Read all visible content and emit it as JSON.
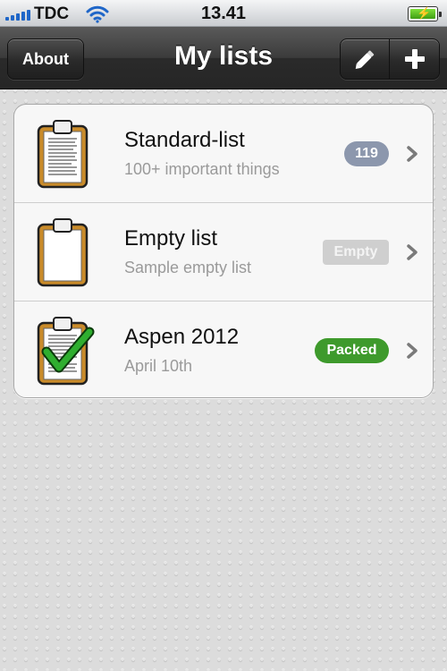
{
  "status_bar": {
    "carrier": "TDC",
    "time": "13.41",
    "icons": [
      "signal-icon",
      "wifi-icon",
      "battery-charging-icon"
    ]
  },
  "nav": {
    "title": "My lists",
    "about_label": "About",
    "icons": [
      "pencil-icon",
      "plus-icon"
    ]
  },
  "lists": [
    {
      "title": "Standard-list",
      "subtitle": "100+ important things",
      "badge": "119",
      "badge_style": "count",
      "icon": "clipboard-filled-icon"
    },
    {
      "title": "Empty list",
      "subtitle": "Sample empty list",
      "badge": "Empty",
      "badge_style": "empty",
      "icon": "clipboard-empty-icon"
    },
    {
      "title": "Aspen 2012",
      "subtitle": "April 10th",
      "badge": "Packed",
      "badge_style": "packed",
      "icon": "clipboard-checked-icon"
    }
  ],
  "colors": {
    "count_badge": "#8c97ad",
    "empty_badge": "#cfcfcf",
    "packed_badge": "#3e9a2c",
    "signal": "#1f66c8",
    "battery": "#4fc41f"
  }
}
